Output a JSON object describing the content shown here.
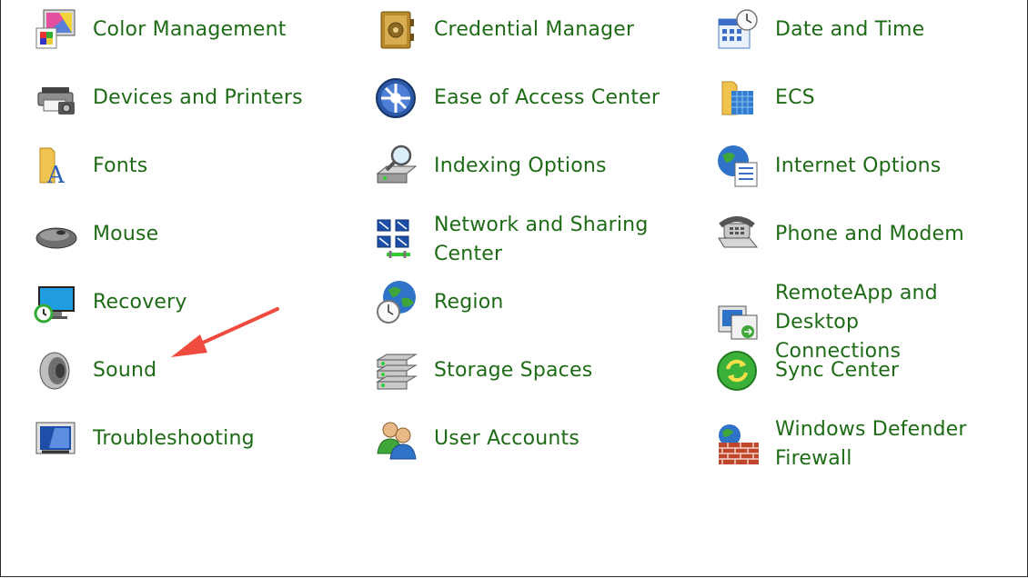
{
  "items": [
    {
      "label": "Color Management",
      "icon": "color-management-icon"
    },
    {
      "label": "Credential Manager",
      "icon": "credential-manager-icon"
    },
    {
      "label": "Date and Time",
      "icon": "date-time-icon"
    },
    {
      "label": "Devices and Printers",
      "icon": "devices-printers-icon"
    },
    {
      "label": "Ease of Access Center",
      "icon": "ease-of-access-icon"
    },
    {
      "label": "ECS",
      "icon": "folder-icon"
    },
    {
      "label": "Fonts",
      "icon": "fonts-icon"
    },
    {
      "label": "Indexing Options",
      "icon": "indexing-icon"
    },
    {
      "label": "Internet Options",
      "icon": "internet-options-icon"
    },
    {
      "label": "Mouse",
      "icon": "mouse-icon"
    },
    {
      "label": "Network and Sharing\nCenter",
      "icon": "network-icon"
    },
    {
      "label": "Phone and Modem",
      "icon": "phone-icon"
    },
    {
      "label": "Recovery",
      "icon": "recovery-icon"
    },
    {
      "label": "Region",
      "icon": "region-icon"
    },
    {
      "label": "RemoteApp and Desktop\nConnections",
      "icon": "remoteapp-icon"
    },
    {
      "label": "Sound",
      "icon": "speaker-icon"
    },
    {
      "label": "Storage Spaces",
      "icon": "storage-icon"
    },
    {
      "label": "Sync Center",
      "icon": "sync-icon"
    },
    {
      "label": "Troubleshooting",
      "icon": "troubleshooting-icon"
    },
    {
      "label": "User Accounts",
      "icon": "user-accounts-icon"
    },
    {
      "label": "Windows Defender\nFirewall",
      "icon": "firewall-icon"
    }
  ],
  "colors": {
    "link": "#1e6b16",
    "annotation_arrow": "#ef4b3f",
    "background": "#ffffff"
  },
  "annotation": {
    "type": "arrow",
    "points_to": "Sound"
  }
}
